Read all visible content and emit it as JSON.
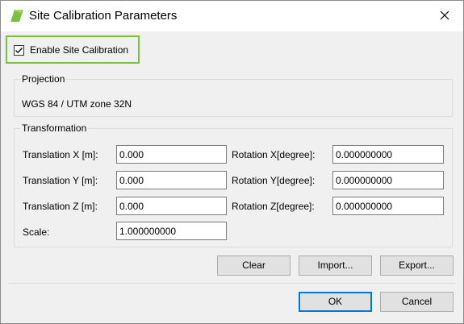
{
  "window": {
    "title": "Site Calibration Parameters"
  },
  "enable": {
    "label": "Enable Site Calibration",
    "checked": true,
    "highlight_color": "#7ac143"
  },
  "projection": {
    "legend": "Projection",
    "value": "WGS 84 / UTM zone 32N"
  },
  "transformation": {
    "legend": "Transformation",
    "translation_x": {
      "label": "Translation X [m]:",
      "value": "0.000"
    },
    "translation_y": {
      "label": "Translation Y [m]:",
      "value": "0.000"
    },
    "translation_z": {
      "label": "Translation Z [m]:",
      "value": "0.000"
    },
    "rotation_x": {
      "label": "Rotation X[degree]:",
      "value": "0.000000000"
    },
    "rotation_y": {
      "label": "Rotation Y[degree]:",
      "value": "0.000000000"
    },
    "rotation_z": {
      "label": "Rotation Z[degree]:",
      "value": "0.000000000"
    },
    "scale": {
      "label": "Scale:",
      "value": "1.000000000"
    }
  },
  "actions": {
    "clear": "Clear",
    "import": "Import...",
    "export": "Export..."
  },
  "dialog_buttons": {
    "ok": "OK",
    "cancel": "Cancel"
  },
  "icons": {
    "app": "app-logo-icon",
    "close": "close-icon",
    "check": "checkmark-icon"
  },
  "colors": {
    "accent": "#0078d7",
    "app_icon": "#7ac143"
  }
}
